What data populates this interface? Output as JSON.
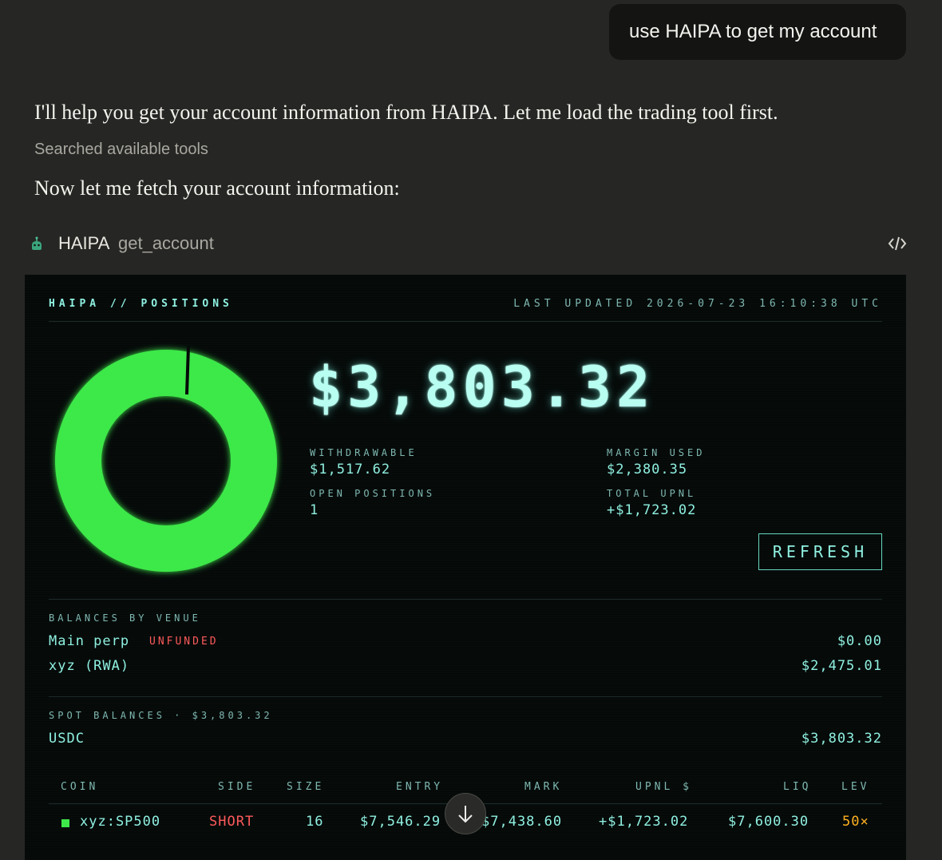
{
  "user_message": "use HAIPA to get my account",
  "assistant": {
    "intro": "I'll help you get your account information from HAIPA. Let me load the trading tool first.",
    "searched": "Searched available tools",
    "fetch": "Now let me fetch your account information:"
  },
  "tool": {
    "name": "HAIPA",
    "function": "get_account",
    "icon": "robot-icon",
    "code_icon": "code-icon"
  },
  "panel": {
    "title": "HAIPA // POSITIONS",
    "updated": "LAST UPDATED 2026-07-23 16:10:38 UTC",
    "total": "$3,803.32",
    "donut_fraction_used": 0.985,
    "stats": {
      "withdrawable_label": "WITHDRAWABLE",
      "withdrawable": "$1,517.62",
      "margin_label": "MARGIN USED",
      "margin": "$2,380.35",
      "open_label": "OPEN POSITIONS",
      "open": "1",
      "upnl_label": "TOTAL UPNL",
      "upnl": "+$1,723.02"
    },
    "refresh_label": "REFRESH",
    "balances_label": "BALANCES BY VENUE",
    "venues": [
      {
        "name": "Main perp",
        "badge": "UNFUNDED",
        "value": "$0.00"
      },
      {
        "name": "xyz (RWA)",
        "value": "$2,475.01"
      }
    ],
    "spot_label": "SPOT BALANCES · $3,803.32",
    "spot": [
      {
        "name": "USDC",
        "value": "$3,803.32"
      }
    ],
    "table": {
      "headers": [
        "COIN",
        "SIDE",
        "SIZE",
        "ENTRY",
        "MARK",
        "UPNL $",
        "LIQ",
        "LEV"
      ],
      "rows": [
        {
          "coin": "xyz:SP500",
          "side": "SHORT",
          "size": "16",
          "entry": "$7,546.29",
          "mark": "$7,438.60",
          "upnl": "+$1,723.02",
          "liq": "$7,600.30",
          "lev": "50×"
        }
      ]
    },
    "colors": {
      "accent": "#8ff0e0",
      "donut": "#3ee84a",
      "short": "#ff5a5a",
      "lev": "#ffb020"
    }
  },
  "scroll_icon": "arrow-down-icon"
}
